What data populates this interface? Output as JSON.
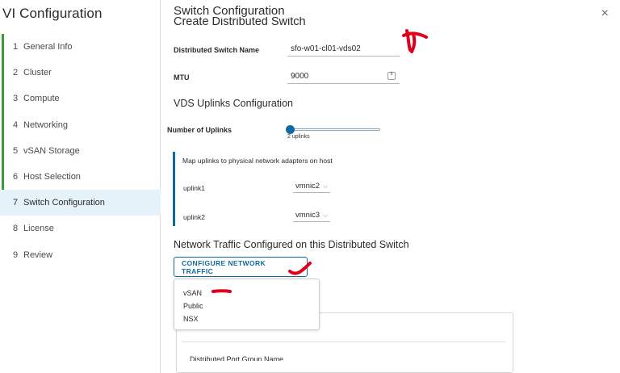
{
  "app": {
    "title": "VI Configuration",
    "close_icon": "×"
  },
  "steps": [
    {
      "num": "1",
      "label": "General Info",
      "state": "done"
    },
    {
      "num": "2",
      "label": "Cluster",
      "state": "done"
    },
    {
      "num": "3",
      "label": "Compute",
      "state": "done"
    },
    {
      "num": "4",
      "label": "Networking",
      "state": "done"
    },
    {
      "num": "5",
      "label": "vSAN Storage",
      "state": "done"
    },
    {
      "num": "6",
      "label": "Host Selection",
      "state": "done"
    },
    {
      "num": "7",
      "label": "Switch Configuration",
      "state": "active"
    },
    {
      "num": "8",
      "label": "License",
      "state": "pending"
    },
    {
      "num": "9",
      "label": "Review",
      "state": "pending"
    }
  ],
  "header": {
    "title": "Switch Configuration",
    "subtitle": "Create Distributed Switch"
  },
  "form": {
    "switch_name_label": "Distributed Switch Name",
    "switch_name_value": "sfo-w01-cl01-vds02",
    "mtu_label": "MTU",
    "mtu_value": "9000",
    "mtu_spin_icon": "⇕"
  },
  "uplinks": {
    "section_title": "VDS Uplinks Configuration",
    "count_label": "Number of Uplinks",
    "count_value": 2,
    "count_min": 2,
    "count_max": 32,
    "count_caption": "2 uplinks",
    "map_heading": "Map uplinks to physical network adapters on host",
    "rows": [
      {
        "label": "uplink1",
        "adapter": "vmnic2"
      },
      {
        "label": "uplink2",
        "adapter": "vmnic3"
      }
    ],
    "chevron": "⌵"
  },
  "traffic": {
    "section_title": "Network Traffic Configured on this Distributed Switch",
    "button_label": "CONFIGURE NETWORK TRAFFIC",
    "button_chevron": "⌵",
    "menu_items": [
      "vSAN",
      "Public",
      "NSX"
    ]
  },
  "card": {
    "partial_text": "Distributed Port Group Name"
  },
  "colors": {
    "accent": "#0f6aa3",
    "done_step": "#3a9b3a",
    "active_step_bg": "#e6f2f9",
    "annotation": "#e0001b"
  }
}
